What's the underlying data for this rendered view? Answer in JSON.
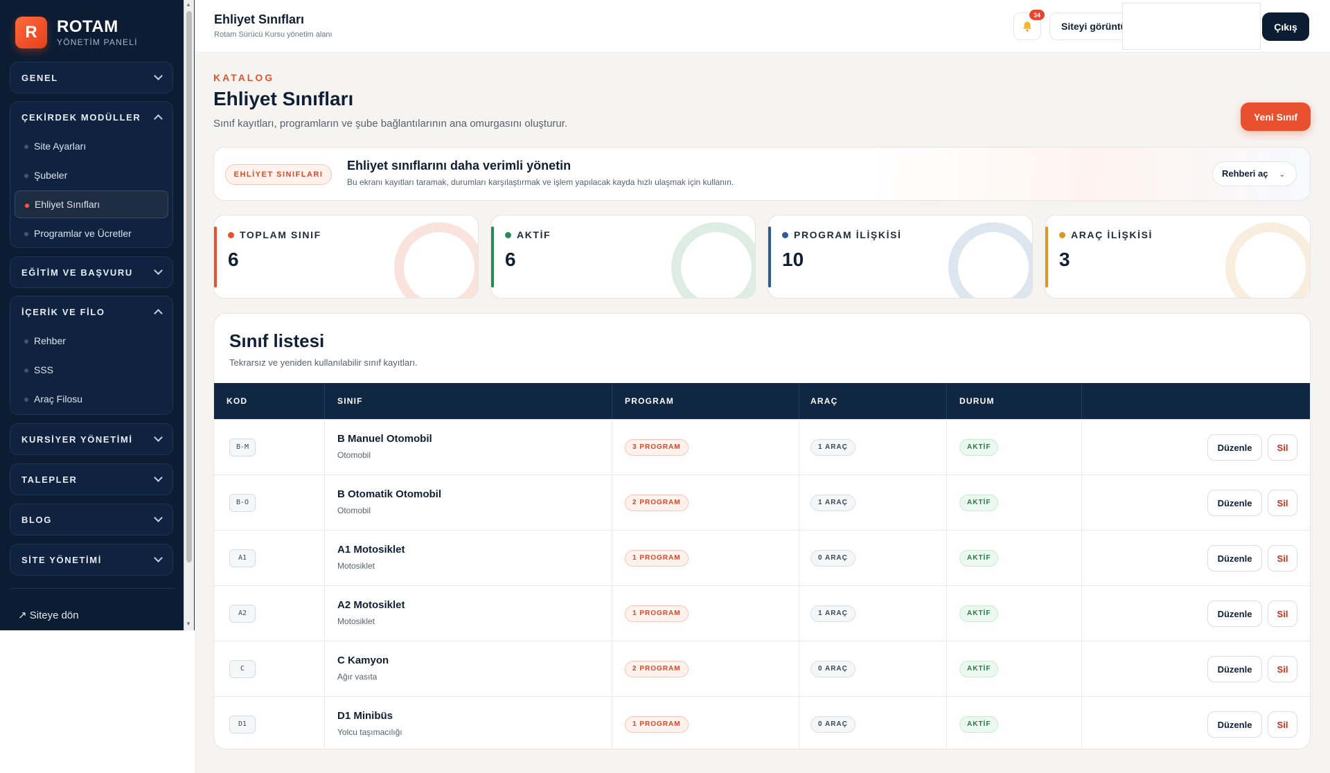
{
  "brand": {
    "logo_letter": "R",
    "title": "ROTAM",
    "subtitle": "YÖNETİM PANELİ"
  },
  "sidebar": {
    "groups": [
      {
        "label": "GENEL",
        "expanded": false,
        "items": []
      },
      {
        "label": "ÇEKİRDEK MODÜLLER",
        "expanded": true,
        "items": [
          {
            "label": "Site Ayarları",
            "active": false
          },
          {
            "label": "Şubeler",
            "active": false
          },
          {
            "label": "Ehliyet Sınıfları",
            "active": true
          },
          {
            "label": "Programlar ve Ücretler",
            "active": false
          }
        ]
      },
      {
        "label": "EĞİTİM VE BAŞVURU",
        "expanded": false,
        "items": []
      },
      {
        "label": "İÇERİK VE FİLO",
        "expanded": true,
        "items": [
          {
            "label": "Rehber",
            "active": false
          },
          {
            "label": "SSS",
            "active": false
          },
          {
            "label": "Araç Filosu",
            "active": false
          }
        ]
      },
      {
        "label": "KURSİYER YÖNETİMİ",
        "expanded": false,
        "items": []
      },
      {
        "label": "TALEPLER",
        "expanded": false,
        "items": []
      },
      {
        "label": "BLOG",
        "expanded": false,
        "items": []
      },
      {
        "label": "SİTE YÖNETİMİ",
        "expanded": false,
        "items": []
      }
    ],
    "back_link": "↗ Siteye dön"
  },
  "topbar": {
    "title": "Ehliyet Sınıfları",
    "subtitle": "Rotam Sürücü Kursu yönetim alanı",
    "notification_count": "34",
    "site_button": "Siteyi görüntüle",
    "logout": "Çıkış"
  },
  "page": {
    "eyebrow": "KATALOG",
    "title": "Ehliyet Sınıfları",
    "description": "Sınıf kayıtları, programların ve şube bağlantılarının ana omurgasını oluşturur.",
    "new_button": "Yeni Sınıf"
  },
  "guide": {
    "pill": "EHLİYET SINIFLARI",
    "title": "Ehliyet sınıflarını daha verimli yönetin",
    "description": "Bu ekranı kayıtları taramak, durumları karşılaştırmak ve işlem yapılacak kayda hızlı ulaşmak için kullanın.",
    "button": "Rehberi aç",
    "button_icon": "⌄"
  },
  "stats": [
    {
      "label": "TOPLAM SINIF",
      "value": "6",
      "color": "#e9502e"
    },
    {
      "label": "AKTİF",
      "value": "6",
      "color": "#2a8a57"
    },
    {
      "label": "PROGRAM İLİŞKİSİ",
      "value": "10",
      "color": "#2d5b95"
    },
    {
      "label": "ARAÇ İLİŞKİSİ",
      "value": "3",
      "color": "#d9962a"
    }
  ],
  "list": {
    "title": "Sınıf listesi",
    "subtitle": "Tekrarsız ve yeniden kullanılabilir sınıf kayıtları.",
    "columns": [
      "KOD",
      "SINIF",
      "PROGRAM",
      "ARAÇ",
      "DURUM"
    ],
    "rows": [
      {
        "code": "B-M",
        "name": "B Manuel Otomobil",
        "category": "Otomobil",
        "program": "3 PROGRAM",
        "arac": "1 ARAÇ",
        "status": "AKTİF",
        "edit": "Düzenle",
        "delete": "Sil"
      },
      {
        "code": "B-O",
        "name": "B Otomatik Otomobil",
        "category": "Otomobil",
        "program": "2 PROGRAM",
        "arac": "1 ARAÇ",
        "status": "AKTİF",
        "edit": "Düzenle",
        "delete": "Sil"
      },
      {
        "code": "A1",
        "name": "A1 Motosiklet",
        "category": "Motosiklet",
        "program": "1 PROGRAM",
        "arac": "0 ARAÇ",
        "status": "AKTİF",
        "edit": "Düzenle",
        "delete": "Sil"
      },
      {
        "code": "A2",
        "name": "A2 Motosiklet",
        "category": "Motosiklet",
        "program": "1 PROGRAM",
        "arac": "1 ARAÇ",
        "status": "AKTİF",
        "edit": "Düzenle",
        "delete": "Sil"
      },
      {
        "code": "C",
        "name": "C Kamyon",
        "category": "Ağır vasıta",
        "program": "2 PROGRAM",
        "arac": "0 ARAÇ",
        "status": "AKTİF",
        "edit": "Düzenle",
        "delete": "Sil"
      },
      {
        "code": "D1",
        "name": "D1 Minibüs",
        "category": "Yolcu taşımacılığı",
        "program": "1 PROGRAM",
        "arac": "0 ARAÇ",
        "status": "AKTİF",
        "edit": "Düzenle",
        "delete": "Sil"
      }
    ]
  }
}
